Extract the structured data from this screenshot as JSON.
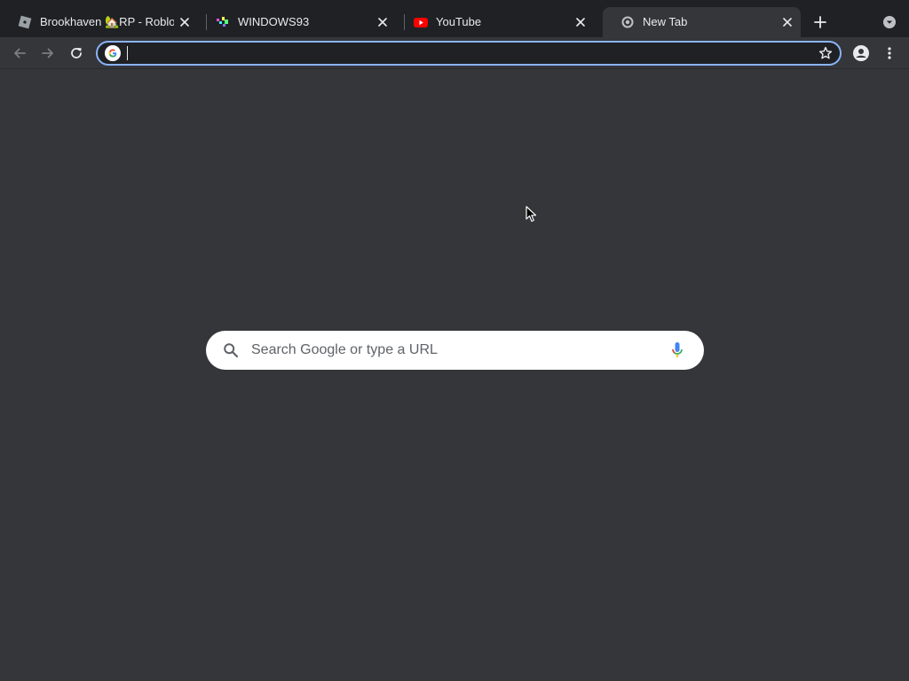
{
  "tabs": [
    {
      "title": "Brookhaven 🏡RP - Roblox",
      "favicon": "roblox-icon",
      "active": false
    },
    {
      "title": "WINDOWS93",
      "favicon": "windows93-icon",
      "active": false
    },
    {
      "title": "YouTube",
      "favicon": "youtube-icon",
      "active": false
    },
    {
      "title": "New Tab",
      "favicon": "chrome-icon",
      "active": true
    }
  ],
  "toolbar": {
    "address_value": "",
    "address_icon": "google-g-icon"
  },
  "ntp": {
    "search_placeholder": "Search Google or type a URL"
  },
  "colors": {
    "tabstrip_bg": "#202124",
    "toolbar_bg": "#35363a",
    "omnibox_focus": "#8ab4f8",
    "page_bg": "#35363a",
    "text": "#e8eaed"
  }
}
